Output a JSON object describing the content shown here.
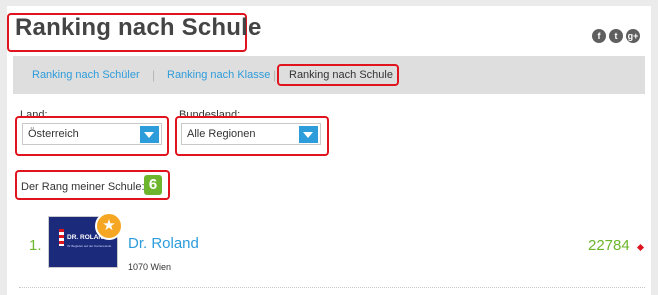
{
  "header": {
    "title": "Ranking nach Schule"
  },
  "social": [
    {
      "icon": "facebook-icon",
      "glyph": "f"
    },
    {
      "icon": "twitter-icon",
      "glyph": "t"
    },
    {
      "icon": "google-plus-icon",
      "glyph": "g+"
    }
  ],
  "tabs": [
    {
      "label": "Ranking nach Schüler",
      "active": false
    },
    {
      "label": "Ranking nach Klasse",
      "active": false
    },
    {
      "label": "Ranking nach Schule",
      "active": true
    }
  ],
  "filters": {
    "land": {
      "label": "Land:",
      "value": "Österreich"
    },
    "bundesland": {
      "label": "Bundesland:",
      "value": "Alle Regionen"
    }
  },
  "rank": {
    "label": "Der Rang meiner Schule:",
    "value": "6"
  },
  "entries": [
    {
      "position": "1.",
      "name": "Dr. Roland",
      "location": "1070 Wien",
      "score": "22784",
      "logo_text": "DR. ROLAND",
      "logo_subtext": "Ihr Begleiter auf der Karrierestufe"
    }
  ],
  "colors": {
    "accent": "#2d9cdb",
    "green": "#6cb52d",
    "highlight": "#e0141e",
    "star": "#f5a623"
  }
}
